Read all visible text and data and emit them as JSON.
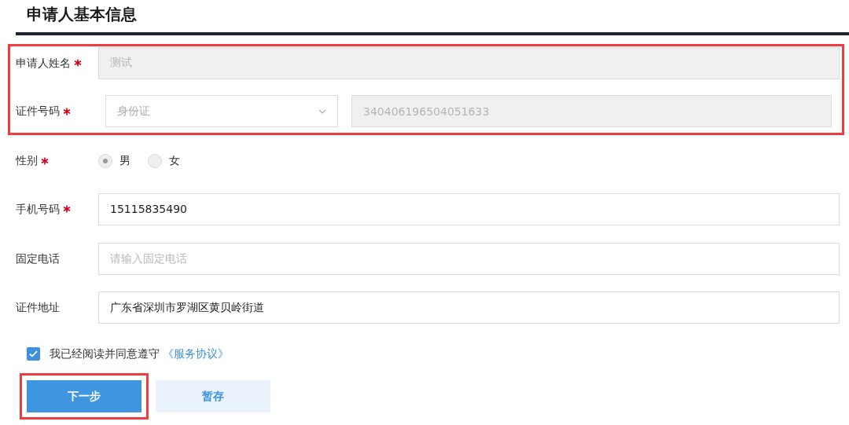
{
  "section_title": "申请人基本信息",
  "highlighted_group": {
    "highlighted": true,
    "rows": [
      {
        "kind": "text",
        "label": "申请人姓名",
        "required": true,
        "value": "测试",
        "disabled": true
      },
      {
        "kind": "id",
        "label": "证件号码",
        "required": true,
        "select_value": "身份证",
        "value": "340406196504051633",
        "disabled": true
      }
    ]
  },
  "rows": [
    {
      "kind": "radio",
      "label": "性别",
      "required": true,
      "options": [
        {
          "label": "男",
          "selected": true
        },
        {
          "label": "女",
          "selected": false
        }
      ]
    },
    {
      "kind": "text",
      "label": "手机号码",
      "required": true,
      "value": "15115835490",
      "disabled": false
    },
    {
      "kind": "text",
      "label": "固定电话",
      "required": false,
      "placeholder": "请输入固定电话",
      "disabled": false
    },
    {
      "kind": "text",
      "label": "证件地址",
      "required": false,
      "value": "广东省深圳市罗湖区黄贝岭街道",
      "disabled": false
    }
  ],
  "agreement": {
    "checked": true,
    "text": "我已经阅读并同意遵守",
    "link": "《服务协议》"
  },
  "buttons": [
    {
      "label": "下一步",
      "kind": "primary",
      "highlighted": true
    },
    {
      "label": "暂存",
      "kind": "secondary",
      "highlighted": false
    }
  ]
}
